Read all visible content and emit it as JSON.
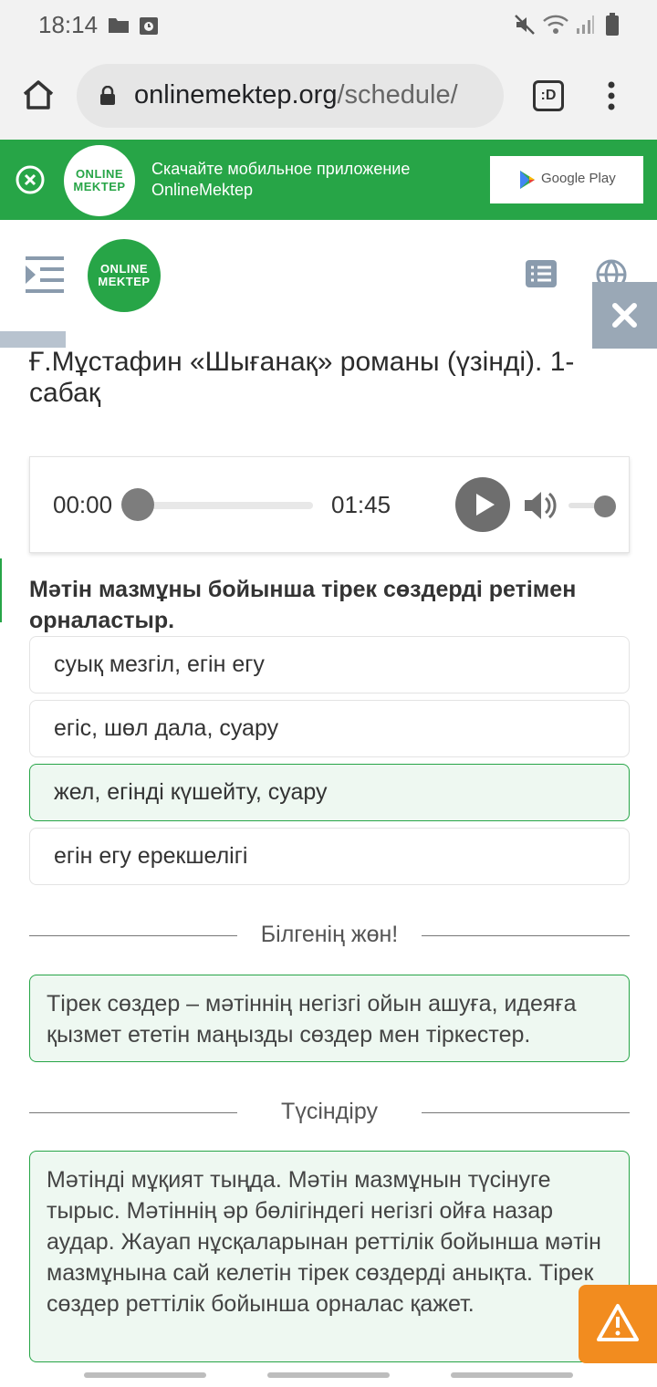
{
  "status_bar": {
    "time": "18:14"
  },
  "browser": {
    "url_host": "onlinemektep.org",
    "url_path": "/schedule/",
    "tab_switch_label": ":D"
  },
  "banner": {
    "logo_line1": "ONLINE",
    "logo_line2": "MEKTEP",
    "text_line1": "Скачайте мобильное приложение",
    "text_line2": "OnlineMektep",
    "store_button": "Google Play"
  },
  "header": {
    "logo_line1": "ONLINE",
    "logo_line2": "MEKTEP"
  },
  "lesson": {
    "title": "Ғ.Мұстафин «Шығанақ» романы (үзінді). 1-сабақ"
  },
  "audio": {
    "current_time": "00:00",
    "duration": "01:45",
    "progress": 0,
    "volume": 1
  },
  "question": {
    "text": "Мәтін мазмұны бойынша тірек сөздерді ретімен орналастыр.",
    "options": [
      {
        "label": "суық мезгіл, егін егу",
        "selected": false
      },
      {
        "label": "егіс, шөл дала, суару",
        "selected": false
      },
      {
        "label": "жел, егінді күшейту, суару",
        "selected": true
      },
      {
        "label": "егін егу ерекшелігі",
        "selected": false
      }
    ]
  },
  "hint": {
    "heading": "Білгенің жөн!",
    "text": "Тірек сөздер – мәтіннің негізгі ойын ашуға, идеяға қызмет ететін маңызды сөздер мен тіркестер."
  },
  "explanation": {
    "heading": "Түсіндіру",
    "text": "Мәтінді мұқият тыңда. Мәтін мазмұнын түсінуге тырыс. Мәтіннің әр бөлігіндегі негізгі ойға назар аудар. Жауап нұсқаларынан реттілік бойынша мәтін мазмұнына сай келетін тірек сөздерді анықта. Тірек сөздер реттілік бойынша орналас қажет."
  },
  "colors": {
    "brand_green": "#27a547",
    "selected_bg": "#eef8f1",
    "warning_orange": "#f28c1f",
    "close_panel": "#9aa8b6"
  }
}
